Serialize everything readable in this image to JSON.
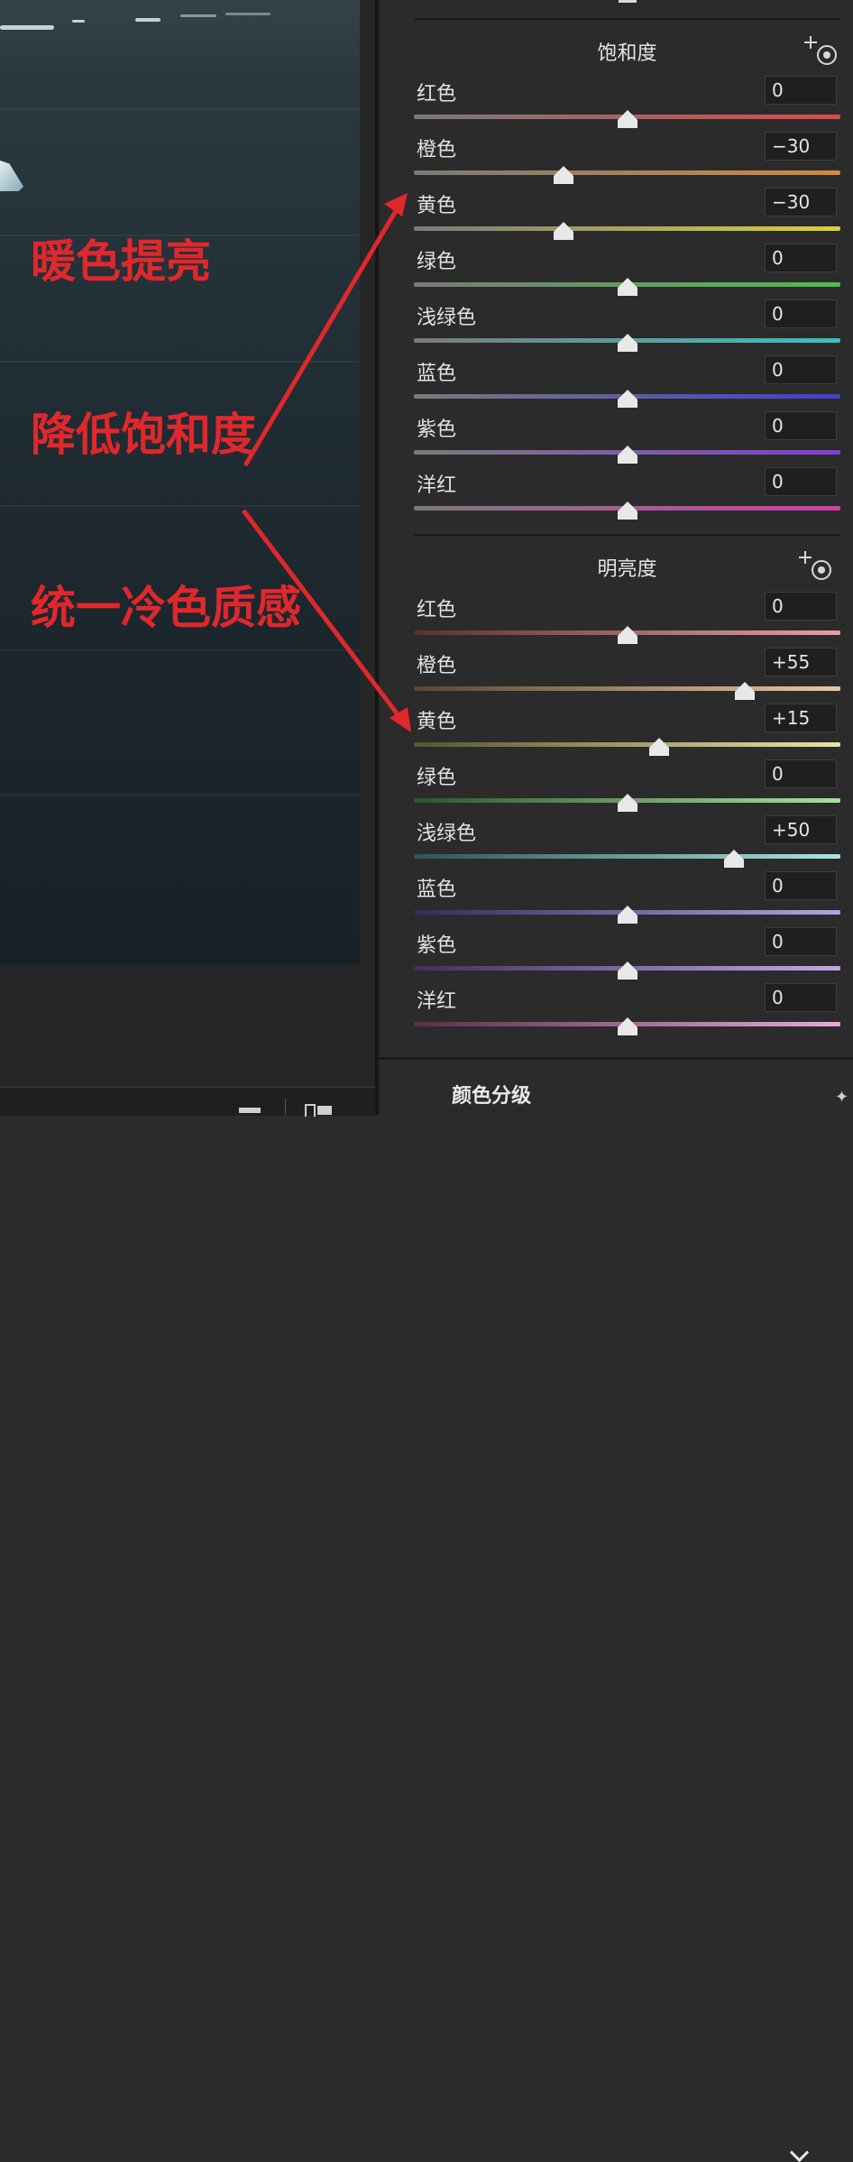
{
  "annotation": {
    "lines": [
      "暖色提亮",
      "降低饱和度",
      "统一冷色质感"
    ],
    "color": "#e0282c"
  },
  "saturation": {
    "title": "饱和度",
    "target_icon": "target-adjust-icon",
    "rows": [
      {
        "label": "红色",
        "value": "0",
        "level": 0,
        "colors": [
          "#7a7a7a",
          "#d94a4a"
        ]
      },
      {
        "label": "橙色",
        "value": "−30",
        "level": -30,
        "colors": [
          "#7a7a7a",
          "#d68a3c"
        ]
      },
      {
        "label": "黄色",
        "value": "−30",
        "level": -30,
        "colors": [
          "#7a7a7a",
          "#d8d23a"
        ]
      },
      {
        "label": "绿色",
        "value": "0",
        "level": 0,
        "colors": [
          "#7a7a7a",
          "#4ac04a"
        ]
      },
      {
        "label": "浅绿色",
        "value": "0",
        "level": 0,
        "colors": [
          "#7a7a7a",
          "#3cc0c0"
        ]
      },
      {
        "label": "蓝色",
        "value": "0",
        "level": 0,
        "colors": [
          "#7a7a7a",
          "#4040d0"
        ]
      },
      {
        "label": "紫色",
        "value": "0",
        "level": 0,
        "colors": [
          "#7a7a7a",
          "#8040d0"
        ]
      },
      {
        "label": "洋红",
        "value": "0",
        "level": 0,
        "colors": [
          "#7a7a7a",
          "#d040a8"
        ]
      }
    ]
  },
  "luminance": {
    "title": "明亮度",
    "target_icon": "target-adjust-icon",
    "rows": [
      {
        "label": "红色",
        "value": "0",
        "level": 0,
        "colors": [
          "#5a3030",
          "#e8a0a0"
        ]
      },
      {
        "label": "橙色",
        "value": "+55",
        "level": 55,
        "colors": [
          "#5a4430",
          "#e8c8a8"
        ]
      },
      {
        "label": "黄色",
        "value": "+15",
        "level": 15,
        "colors": [
          "#55552e",
          "#e6e6a4"
        ]
      },
      {
        "label": "绿色",
        "value": "0",
        "level": 0,
        "colors": [
          "#2e552e",
          "#a8e0a0"
        ]
      },
      {
        "label": "浅绿色",
        "value": "+50",
        "level": 50,
        "colors": [
          "#2e5550",
          "#a8e6e0"
        ]
      },
      {
        "label": "蓝色",
        "value": "0",
        "level": 0,
        "colors": [
          "#2e2e60",
          "#a8a8e6"
        ]
      },
      {
        "label": "紫色",
        "value": "0",
        "level": 0,
        "colors": [
          "#402e60",
          "#c0a8e6"
        ]
      },
      {
        "label": "洋红",
        "value": "0",
        "level": 0,
        "colors": [
          "#5a2e4a",
          "#e8a8d8"
        ]
      }
    ]
  },
  "footer": {
    "chevron_icon": "chevron-down-icon",
    "title": "颜色分级"
  },
  "arrow_color": "#e0282c"
}
